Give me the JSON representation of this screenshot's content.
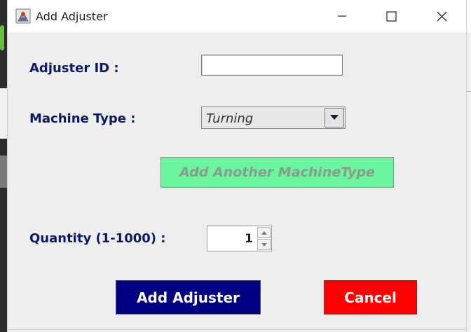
{
  "window": {
    "title": "Add Adjuster",
    "controls": [
      "minimize-icon",
      "maximize-icon",
      "close-icon"
    ]
  },
  "form": {
    "adjuster_id_label": "Adjuster ID :",
    "adjuster_id_value": "",
    "machine_type_label": "Machine Type :",
    "machine_type_value": "Turning",
    "add_machine_type_label": "Add Another MachineType",
    "quantity_label": "Quantity (1-1000) :",
    "quantity_value": "1"
  },
  "actions": {
    "add_label": "Add Adjuster",
    "cancel_label": "Cancel"
  },
  "colors": {
    "label_text": "#0b1a66",
    "add_button": "#000080",
    "cancel_button": "#ff0000",
    "add_type_button": "#6cf59f"
  }
}
